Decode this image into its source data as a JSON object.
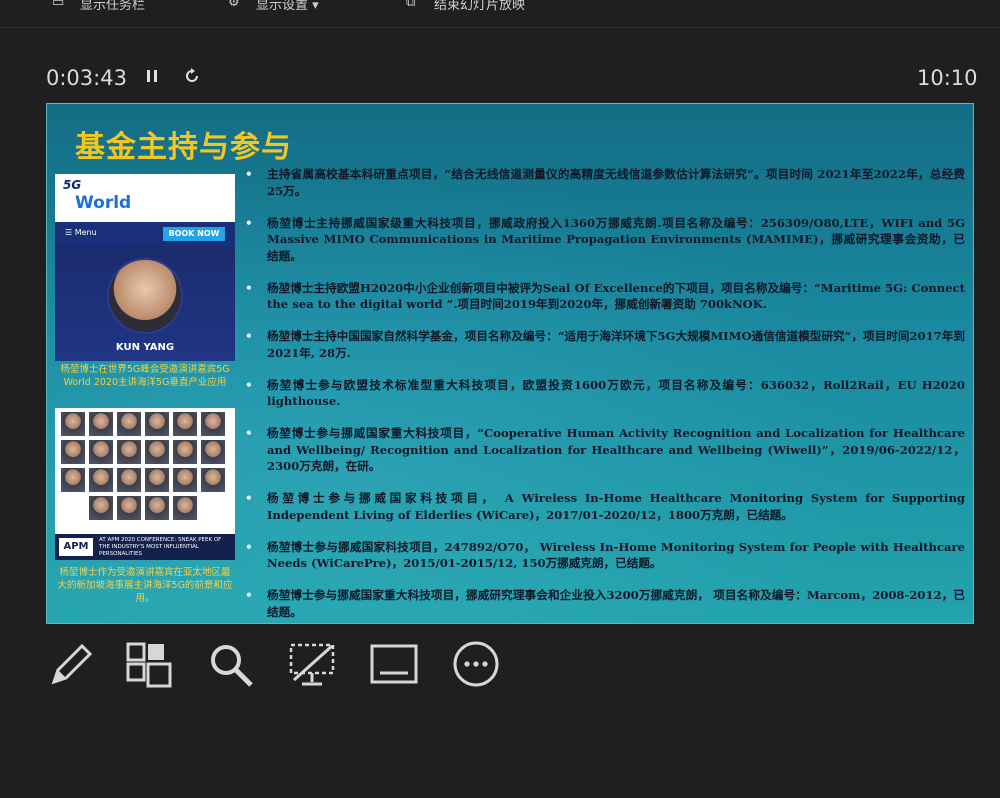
{
  "toolbar": {
    "show_taskbar": "显示任务栏",
    "display_settings": "显示设置 ▾",
    "end_slideshow": "结束幻灯片放映"
  },
  "timer": {
    "elapsed": "0:03:43",
    "clock": "10:10"
  },
  "slide": {
    "title": "基金主持与参与",
    "image1": {
      "logo_5g": "5G",
      "logo_world": "World",
      "menu": "☰  Menu",
      "book_now": "BOOK NOW",
      "person_name": "KUN YANG",
      "caption": "杨堃博士在世界5G峰会受邀演讲嘉宾5G World 2020主讲海洋5G垂直产业应用"
    },
    "image2": {
      "apm": "APM",
      "apm_text": "AT APM 2020 CONFERENCE: SNEAK PEEK OF THE INDUSTRY'S MOST INFLUENTIAL PERSONALITIES",
      "caption": "杨堃博士作为受邀演讲嘉宾在亚太地区最大的新加坡海事展主讲海洋5G的前景和应用。"
    },
    "bullets": [
      "主持省属高校基本科研重点项目，“结合无线信道测量仪的高精度无线信道参数估计算法研究”。项目时间 2021年至2022年，总经费25万。",
      "杨堃博士主持挪威国家级重大科技项目，挪威政府投入1360万挪威克朗.项目名称及编号：256309/O80,LTE，WIFI and 5G Massive MIMO Communications in Maritime Propagation Environments (MAMIME)，挪威研究理事会资助，已结题。",
      "杨堃博士主持欧盟H2020中小企业创新项目中被评为Seal Of Excellence的下项目，项目名称及编号：“Maritime 5G: Connect the sea to the digital world ”.项目时间2019年到2020年，挪威创新署资助 700kNOK.",
      "杨堃博士主持中国国家自然科学基金，项目名称及编号：“适用于海洋环境下5G大规模MIMO通信信道模型研究”，项目时间2017年到2021年, 28万.",
      "杨堃博士参与欧盟技术标准型重大科技项目，欧盟投资1600万欧元，项目名称及编号：636032，Roll2Rail，EU H2020 lighthouse.",
      "杨堃博士参与挪威国家重大科技项目，“Cooperative Human Activity Recognition and Localization for Healthcare and Wellbeing/ Recognition and Localization for Healthcare and Wellbeing (Wiwell)”，2019/06-2022/12，2300万克朗，在研。",
      "杨堃博士参与挪威国家科技项目， A Wireless In-Home Healthcare Monitoring System for Supporting Independent Living of Elderlies (WiCare)，2017/01-2020/12，1800万克朗，已结题。",
      "杨堃博士参与挪威国家科技项目，247892/O70， Wireless In-Home Monitoring System for People with Healthcare Needs (WiCarePre)，2015/01-2015/12, 150万挪威克朗，已结题。",
      "杨堃博士参与挪威国家重大科技项目，挪威研究理事会和企业投入3200万挪威克朗， 项目名称及编号：Marcom，2008-2012，已结题。"
    ]
  },
  "tools": [
    "pen-icon",
    "slides-grid-icon",
    "zoom-icon",
    "screen-off-icon",
    "subtitles-icon",
    "more-options-icon"
  ]
}
